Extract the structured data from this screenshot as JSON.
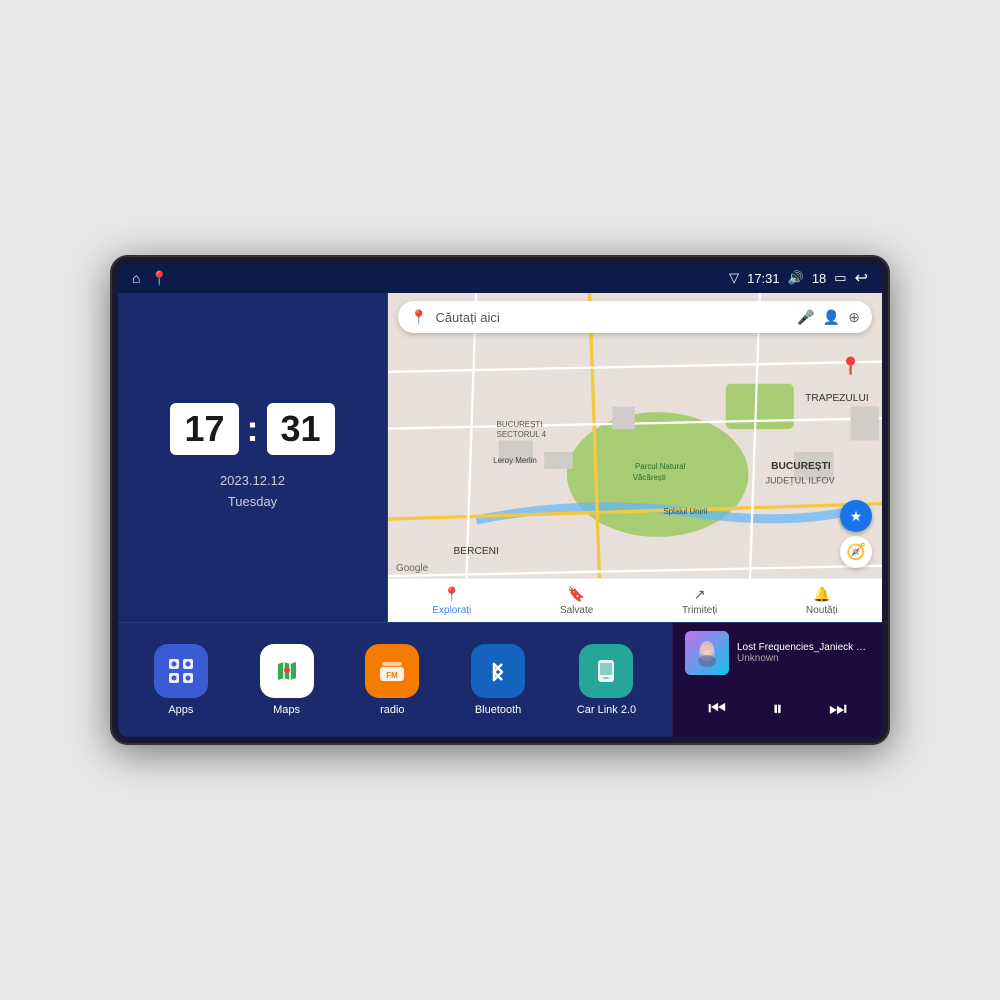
{
  "device": {
    "screen_bg": "#0d1b4b"
  },
  "status_bar": {
    "signal_icon": "▽",
    "time": "17:31",
    "volume_icon": "🔊",
    "battery_level": "18",
    "battery_icon": "▭",
    "back_icon": "↩"
  },
  "clock_widget": {
    "hour": "17",
    "minute": "31",
    "date": "2023.12.12",
    "day": "Tuesday"
  },
  "map_widget": {
    "search_placeholder": "Căutați aici",
    "bottom_items": [
      {
        "label": "Explorați",
        "active": true
      },
      {
        "label": "Salvate",
        "active": false
      },
      {
        "label": "Trimiteți",
        "active": false
      },
      {
        "label": "Noutăți",
        "active": false
      }
    ],
    "locations": {
      "trapezului": "TRAPEZULUI",
      "bucuresti": "BUCUREȘTI",
      "judetul_ilfov": "JUDEȚUL ILFOV",
      "berceni": "BERCENI",
      "leroy_merlin": "Leroy Merlin",
      "parcul_natural": "Parcul Natural Văcărești",
      "splai_unirii": "Splaiul Unirii",
      "sector_4": "BUCUREȘTI\nSECTORUL 4"
    }
  },
  "app_icons": [
    {
      "id": "apps",
      "label": "Apps",
      "bg": "#3a5bd4",
      "emoji": "⊞"
    },
    {
      "id": "maps",
      "label": "Maps",
      "bg": "#34a853",
      "emoji": "🗺"
    },
    {
      "id": "radio",
      "label": "radio",
      "bg": "#f57c00",
      "emoji": "📻"
    },
    {
      "id": "bluetooth",
      "label": "Bluetooth",
      "bg": "#1e88e5",
      "emoji": "🔷"
    },
    {
      "id": "carlink",
      "label": "Car Link 2.0",
      "bg": "#26a69a",
      "emoji": "📱"
    }
  ],
  "music_player": {
    "title": "Lost Frequencies_Janieck Devy-...",
    "artist": "Unknown",
    "prev_icon": "⏮",
    "play_icon": "⏸",
    "next_icon": "⏭"
  }
}
